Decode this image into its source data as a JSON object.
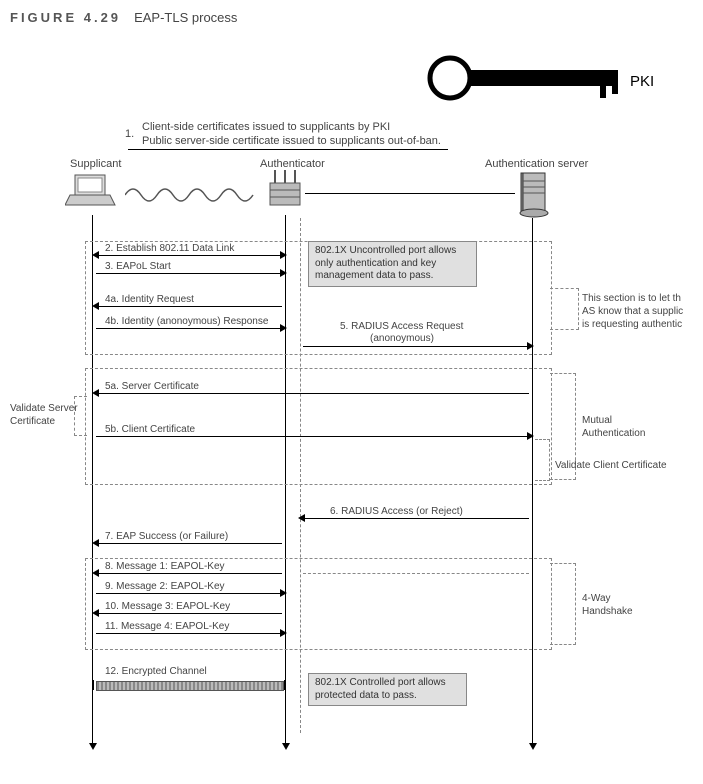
{
  "figure": {
    "number": "FIGURE 4.29",
    "title": "EAP-TLS process"
  },
  "pki_label": "PKI",
  "step1_header": "1.",
  "step1_line_a": "Client-side certificates issued to supplicants by PKI",
  "step1_line_b": "Public server-side certificate issued to supplicants out-of-ban.",
  "roles": {
    "supplicant": "Supplicant",
    "authenticator": "Authenticator",
    "auth_server": "Authentication server"
  },
  "msgs": {
    "s2": "2. Establish 802.11 Data Link",
    "s3": "3. EAPoL Start",
    "s4a": "4a. Identity Request",
    "s4b": "4b. Identity (anonoymous) Response",
    "s5a": "5. RADIUS Access Request",
    "s5b": "(anonoymous)",
    "s5c": "5a. Server Certificate",
    "s5d": "5b. Client Certificate",
    "s6": "6. RADIUS Access (or Reject)",
    "s7": "7. EAP Success (or Failure)",
    "s8": "8. Message 1: EAPOL-Key",
    "s9": "9. Message 2: EAPOL-Key",
    "s10": "10. Message 3: EAPOL-Key",
    "s11": "11. Message 4: EAPOL-Key",
    "s12": "12. Encrypted Channel"
  },
  "boxes": {
    "uncontrolled": "802.1X Uncontrolled port allows only authentication and key management data to pass.",
    "controlled": "802.1X Controlled port allows protected data to pass."
  },
  "notes": {
    "identity_section_a": "This section is to let th",
    "identity_section_b": "AS know that a supplic",
    "identity_section_c": "is requesting authentic",
    "validate_server": "Validate Server Certificate",
    "mutual_auth": "Mutual Authentication",
    "validate_client": "Validate Client Certificate",
    "handshake": "4-Way Handshake"
  }
}
